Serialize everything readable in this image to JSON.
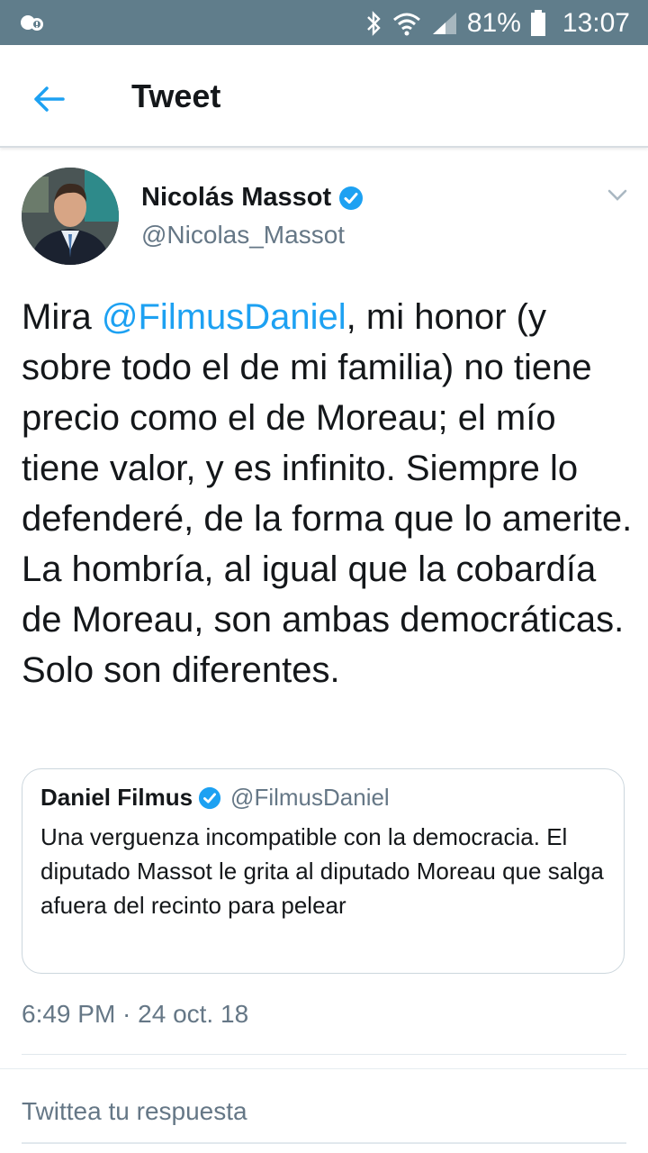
{
  "status_bar": {
    "battery": "81%",
    "time": "13:07",
    "icons": [
      "notification-icon",
      "bluetooth-icon",
      "wifi-icon",
      "signal-icon",
      "battery-icon"
    ]
  },
  "app_bar": {
    "title": "Tweet",
    "back_icon": "arrow-left-icon"
  },
  "tweet": {
    "author_name": "Nicolás Massot",
    "author_handle": "@Nicolas_Massot",
    "verified": true,
    "text_prefix": "Mira ",
    "mention": "@FilmusDaniel",
    "text_rest": ", mi honor (y sobre todo el de mi familia) no tiene precio como el de Moreau; el mío tiene valor, y es infinito. Siempre lo defenderé, de la forma que lo amerite. La hombría, al igual que la cobardía de Moreau, son ambas democráticas. Solo son diferentes.",
    "timestamp": "6:49 PM · 24 oct. 18"
  },
  "quoted_tweet": {
    "author_name": "Daniel Filmus",
    "author_handle": "@FilmusDaniel",
    "verified": true,
    "text": "Una verguenza incompatible  con la democracia. El diputado Massot le grita al diputado Moreau que salga afuera del recinto para pelear"
  },
  "reply_box": {
    "placeholder": "Twittea tu respuesta"
  },
  "colors": {
    "status_bar": "#607d8b",
    "link_blue": "#1da1f2",
    "secondary_text": "#657786",
    "primary_text": "#14171a"
  }
}
